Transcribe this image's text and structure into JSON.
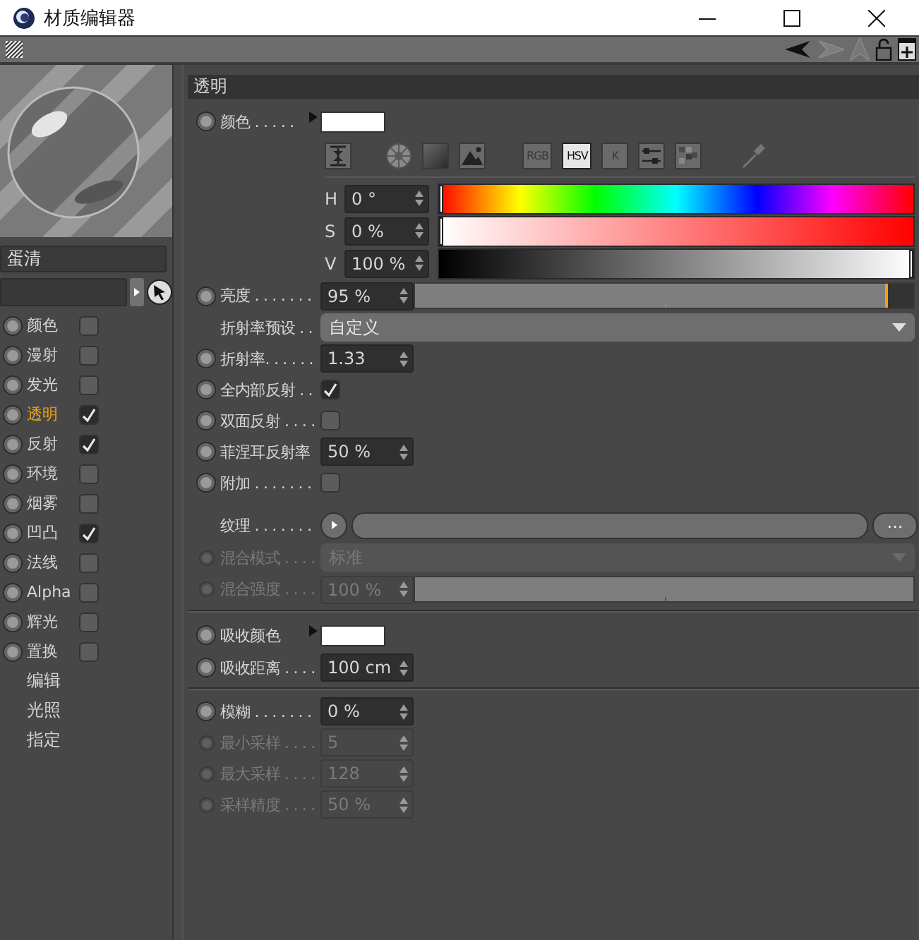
{
  "window": {
    "title": "材质编辑器"
  },
  "material": {
    "name": "蛋清"
  },
  "channels": [
    {
      "label": "颜色",
      "checked": false,
      "selected": false
    },
    {
      "label": "漫射",
      "checked": false,
      "selected": false
    },
    {
      "label": "发光",
      "checked": false,
      "selected": false
    },
    {
      "label": "透明",
      "checked": true,
      "selected": true
    },
    {
      "label": "反射",
      "checked": true,
      "selected": false
    },
    {
      "label": "环境",
      "checked": false,
      "selected": false
    },
    {
      "label": "烟雾",
      "checked": false,
      "selected": false
    },
    {
      "label": "凹凸",
      "checked": true,
      "selected": false
    },
    {
      "label": "法线",
      "checked": false,
      "selected": false
    },
    {
      "label": "Alpha",
      "checked": false,
      "selected": false
    },
    {
      "label": "辉光",
      "checked": false,
      "selected": false
    },
    {
      "label": "置换",
      "checked": false,
      "selected": false
    }
  ],
  "links": [
    {
      "label": "编辑"
    },
    {
      "label": "光照"
    },
    {
      "label": "指定"
    }
  ],
  "section": {
    "title": "透明"
  },
  "rows": [
    {
      "kind": "color",
      "label": "颜色 . . . . .",
      "animatable": true,
      "disabled": false,
      "color": "#ffffff"
    },
    {
      "kind": "modes",
      "modes": [
        {
          "label": "RGB",
          "selected": false
        },
        {
          "label": "HSV",
          "selected": true
        },
        {
          "label": "K",
          "selected": false
        }
      ]
    },
    {
      "kind": "hue",
      "label": "H",
      "value": "0 °",
      "level": 0
    },
    {
      "kind": "saturation",
      "label": "S",
      "value": "0 %",
      "level": 0
    },
    {
      "kind": "value",
      "label": "V",
      "value": "100 %",
      "level": 1
    },
    {
      "kind": "slider",
      "label": "亮度 . . . . . . .",
      "animatable": true,
      "disabled": false,
      "value": "95 %",
      "level": 0.95
    },
    {
      "kind": "dropdown",
      "label": "折射率预设 . .",
      "animatable": false,
      "disabled": false,
      "value": "自定义"
    },
    {
      "kind": "number",
      "label": "折射率. . . . . .",
      "animatable": true,
      "disabled": false,
      "value": "1.33"
    },
    {
      "kind": "checkbox",
      "label": "全内部反射 . .",
      "animatable": true,
      "disabled": false,
      "checked": true
    },
    {
      "kind": "checkbox",
      "label": "双面反射 . . . .",
      "animatable": true,
      "disabled": false,
      "checked": false
    },
    {
      "kind": "number",
      "label": "菲涅耳反射率",
      "animatable": true,
      "disabled": false,
      "value": "50 %"
    },
    {
      "kind": "checkbox",
      "label": "附加 . . . . . . .",
      "animatable": true,
      "disabled": false,
      "checked": false
    },
    {
      "kind": "texture",
      "label": "纹理 . . . . . . .",
      "animatable": false,
      "disabled": false,
      "button": "..."
    },
    {
      "kind": "dropdown",
      "label": "混合模式 . . . .",
      "animatable": true,
      "disabled": true,
      "value": "标准"
    },
    {
      "kind": "slider",
      "label": "混合强度 . . . .",
      "animatable": true,
      "disabled": true,
      "value": "100 %",
      "level": 1
    },
    {
      "kind": "divider"
    },
    {
      "kind": "color",
      "label": "吸收颜色",
      "animatable": true,
      "disabled": false,
      "color": "#ffffff"
    },
    {
      "kind": "number",
      "label": "吸收距离 . . . .",
      "animatable": true,
      "disabled": false,
      "value": "100 cm"
    },
    {
      "kind": "divider"
    },
    {
      "kind": "number",
      "label": "模糊 . . . . . . .",
      "animatable": true,
      "disabled": false,
      "value": "0 %"
    },
    {
      "kind": "number",
      "label": "最小采样 . . . .",
      "animatable": true,
      "disabled": true,
      "value": "5"
    },
    {
      "kind": "number",
      "label": "最大采样 . . . .",
      "animatable": true,
      "disabled": true,
      "value": "128"
    },
    {
      "kind": "number",
      "label": "采样精度 . . . .",
      "animatable": true,
      "disabled": true,
      "value": "50 %"
    }
  ]
}
